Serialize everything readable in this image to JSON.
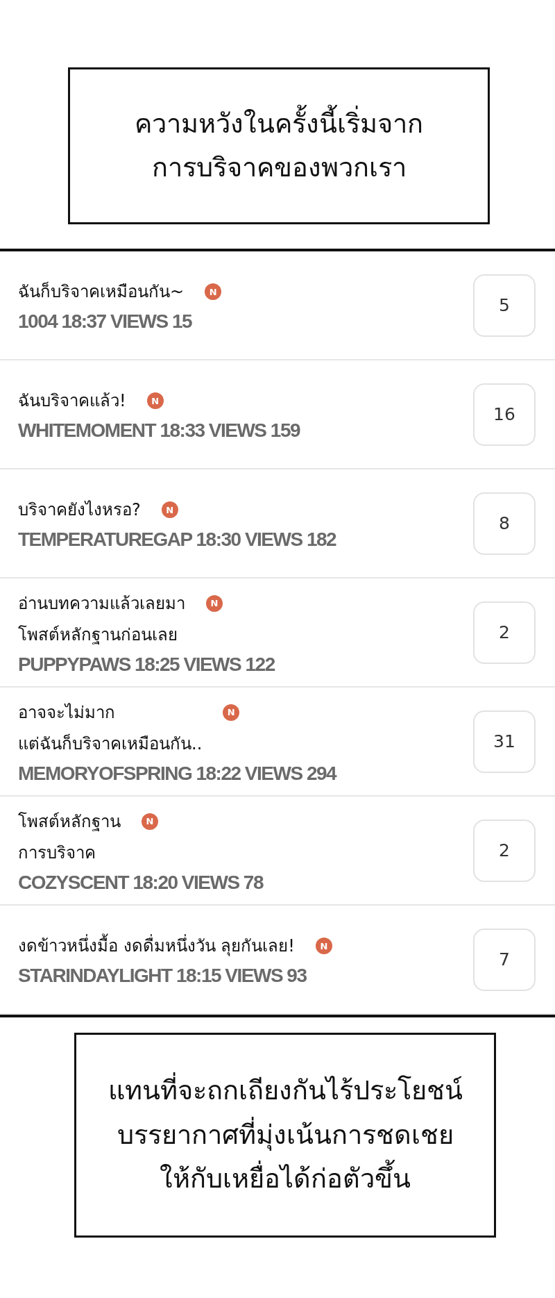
{
  "caption_top": {
    "lines": [
      "ความหวังในครั้งนี้เริ่มจาก",
      "การบริจาคของพวกเรา"
    ]
  },
  "posts": [
    {
      "title": [
        "ฉันก็บริจาคเหมือนกัน~"
      ],
      "badge": "N",
      "meta": "1004 18:37 VIEWS 15",
      "count": "5"
    },
    {
      "title": [
        "ฉันบริจาคแล้ว!"
      ],
      "badge": "N",
      "meta": "WHITEMOMENT 18:33 VIEWS 159",
      "count": "16"
    },
    {
      "title": [
        "บริจาคยังไงหรอ?"
      ],
      "badge": "N",
      "meta": "TEMPERATUREGAP 18:30 VIEWS 182",
      "count": "8"
    },
    {
      "title": [
        "อ่านบทความแล้วเลยมา",
        "โพสต์หลักฐานก่อนเลย"
      ],
      "badge": "N",
      "meta": "PUPPYPAWS 18:25 VIEWS 122",
      "count": "2"
    },
    {
      "title": [
        "อาจจะไม่มาก",
        "แต่ฉันก็บริจาคเหมือนกัน.."
      ],
      "badge": "N",
      "meta": "MEMORYOFSPRING 18:22 VIEWS 294",
      "count": "31"
    },
    {
      "title": [
        "โพสต์หลักฐาน",
        "การบริจาค"
      ],
      "badge": "N",
      "meta": "COZYSCENT 18:20 VIEWS 78",
      "count": "2"
    },
    {
      "title": [
        "งดข้าวหนึ่งมื้อ งดดื่มหนึ่งวัน ลุยกันเลย!"
      ],
      "badge": "N",
      "meta": "STARINDAYLIGHT 18:15 VIEWS 93",
      "count": "7"
    }
  ],
  "caption_bottom": {
    "lines": [
      "แทนที่จะถกเถียงกันไร้ประโยชน์",
      "บรรยากาศที่มุ่งเน้นการชดเชย",
      "ให้กับเหยื่อได้ก่อตัวขึ้น"
    ]
  }
}
